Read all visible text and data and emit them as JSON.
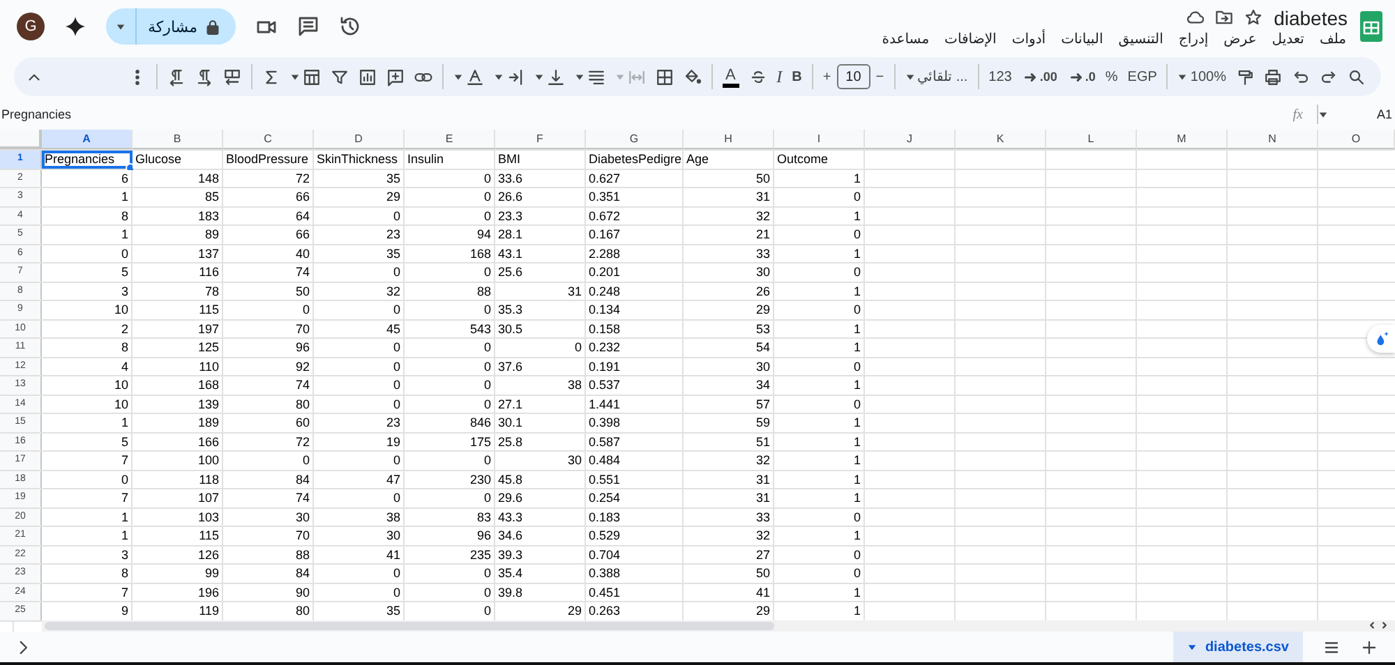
{
  "document": {
    "title": "diabetes"
  },
  "account": {
    "initial": "G"
  },
  "share": {
    "label": "مشاركة"
  },
  "menu": [
    "ملف",
    "تعديل",
    "عرض",
    "إدراج",
    "التنسيق",
    "البيانات",
    "أدوات",
    "الإضافات",
    "مساعدة"
  ],
  "toolbar": [
    {
      "kind": "icon",
      "disabled": false
    },
    {
      "kind": "divider"
    },
    {
      "kind": "icon",
      "disabled": false
    },
    {
      "kind": "icon",
      "disabled": false
    },
    {
      "kind": "icon",
      "disabled": false
    },
    {
      "kind": "divider"
    },
    {
      "kind": "icon",
      "disabled": false
    },
    {
      "kind": "icon",
      "disabled": false,
      "caret": true
    },
    {
      "kind": "icon",
      "disabled": false
    },
    {
      "kind": "icon",
      "disabled": false
    },
    {
      "kind": "icon",
      "disabled": false
    },
    {
      "kind": "icon",
      "disabled": false
    },
    {
      "kind": "divider"
    },
    {
      "kind": "icon",
      "disabled": false,
      "caret": true
    },
    {
      "kind": "icon",
      "disabled": false,
      "caret": true
    },
    {
      "kind": "icon",
      "disabled": false,
      "caret": true
    },
    {
      "kind": "icon",
      "disabled": false,
      "caret": true
    },
    {
      "kind": "icon",
      "disabled": true,
      "caret": true
    },
    {
      "kind": "icon",
      "disabled": false
    },
    {
      "kind": "icon",
      "disabled": false
    },
    {
      "kind": "divider"
    },
    {
      "kind": "underlined",
      "label": "A"
    },
    {
      "kind": "icon",
      "disabled": false
    },
    {
      "kind": "italic",
      "label": "I"
    },
    {
      "kind": "bold",
      "label": "B"
    },
    {
      "kind": "divider"
    },
    {
      "kind": "text",
      "label": "+"
    },
    {
      "kind": "field",
      "value": "10"
    },
    {
      "kind": "text",
      "label": "−"
    },
    {
      "kind": "divider"
    },
    {
      "kind": "dropdown",
      "label": "تلقائي ..."
    },
    {
      "kind": "divider"
    },
    {
      "kind": "text",
      "label": "123"
    },
    {
      "kind": "decimal",
      "label": ".00"
    },
    {
      "kind": "decimal",
      "label": ".0"
    },
    {
      "kind": "text",
      "label": "%"
    },
    {
      "kind": "text",
      "label": "EGP"
    },
    {
      "kind": "divider"
    },
    {
      "kind": "dropdown",
      "label": "100%"
    },
    {
      "kind": "icon",
      "disabled": false
    },
    {
      "kind": "icon",
      "disabled": false
    },
    {
      "kind": "icon",
      "disabled": false
    },
    {
      "kind": "icon",
      "disabled": false
    },
    {
      "kind": "icon",
      "disabled": false
    }
  ],
  "formula_bar": {
    "name_box": "A1",
    "fx_label": "fx",
    "content": "Pregnancies"
  },
  "grid": {
    "columns": [
      {
        "label": "A",
        "selected": true
      },
      {
        "label": "B",
        "selected": false
      },
      {
        "label": "C",
        "selected": false
      },
      {
        "label": "D",
        "selected": false
      },
      {
        "label": "E",
        "selected": false
      },
      {
        "label": "F",
        "selected": false
      },
      {
        "label": "G",
        "selected": false
      },
      {
        "label": "H",
        "selected": false
      },
      {
        "label": "I",
        "selected": false
      },
      {
        "label": "J",
        "selected": false
      },
      {
        "label": "K",
        "selected": false
      },
      {
        "label": "L",
        "selected": false
      },
      {
        "label": "M",
        "selected": false
      },
      {
        "label": "N",
        "selected": false
      },
      {
        "label": "O",
        "selected": false
      }
    ],
    "rows": [
      {
        "number": "1",
        "selected": true,
        "cells": [
          {
            "text": "Pregnancies"
          },
          {
            "text": "Glucose"
          },
          {
            "text": "BloodPressure"
          },
          {
            "text": "SkinThickness"
          },
          {
            "text": "Insulin"
          },
          {
            "text": "BMI"
          },
          {
            "text": "DiabetesPedigre"
          },
          {
            "text": "Age"
          },
          {
            "text": "Outcome"
          }
        ]
      },
      {
        "number": "2",
        "selected": false,
        "cells": [
          "6",
          "148",
          "72",
          "35",
          "0",
          {
            "text": "33.6"
          },
          {
            "text": "0.627"
          },
          "50",
          "1"
        ]
      },
      {
        "number": "3",
        "selected": false,
        "cells": [
          "1",
          "85",
          "66",
          "29",
          "0",
          {
            "text": "26.6"
          },
          {
            "text": "0.351"
          },
          "31",
          "0"
        ]
      },
      {
        "number": "4",
        "selected": false,
        "cells": [
          "8",
          "183",
          "64",
          "0",
          "0",
          {
            "text": "23.3"
          },
          {
            "text": "0.672"
          },
          "32",
          "1"
        ]
      },
      {
        "number": "5",
        "selected": false,
        "cells": [
          "1",
          "89",
          "66",
          "23",
          "94",
          {
            "text": "28.1"
          },
          {
            "text": "0.167"
          },
          "21",
          "0"
        ]
      },
      {
        "number": "6",
        "selected": false,
        "cells": [
          "0",
          "137",
          "40",
          "35",
          "168",
          {
            "text": "43.1"
          },
          {
            "text": "2.288"
          },
          "33",
          "1"
        ]
      },
      {
        "number": "7",
        "selected": false,
        "cells": [
          "5",
          "116",
          "74",
          "0",
          "0",
          {
            "text": "25.6"
          },
          {
            "text": "0.201"
          },
          "30",
          "0"
        ]
      },
      {
        "number": "8",
        "selected": false,
        "cells": [
          "3",
          "78",
          "50",
          "32",
          "88",
          "31",
          {
            "text": "0.248"
          },
          "26",
          "1"
        ]
      },
      {
        "number": "9",
        "selected": false,
        "cells": [
          "10",
          "115",
          "0",
          "0",
          "0",
          {
            "text": "35.3"
          },
          {
            "text": "0.134"
          },
          "29",
          "0"
        ]
      },
      {
        "number": "10",
        "selected": false,
        "cells": [
          "2",
          "197",
          "70",
          "45",
          "543",
          {
            "text": "30.5"
          },
          {
            "text": "0.158"
          },
          "53",
          "1"
        ]
      },
      {
        "number": "11",
        "selected": false,
        "cells": [
          "8",
          "125",
          "96",
          "0",
          "0",
          "0",
          {
            "text": "0.232"
          },
          "54",
          "1"
        ]
      },
      {
        "number": "12",
        "selected": false,
        "cells": [
          "4",
          "110",
          "92",
          "0",
          "0",
          {
            "text": "37.6"
          },
          {
            "text": "0.191"
          },
          "30",
          "0"
        ]
      },
      {
        "number": "13",
        "selected": false,
        "cells": [
          "10",
          "168",
          "74",
          "0",
          "0",
          "38",
          {
            "text": "0.537"
          },
          "34",
          "1"
        ]
      },
      {
        "number": "14",
        "selected": false,
        "cells": [
          "10",
          "139",
          "80",
          "0",
          "0",
          {
            "text": "27.1"
          },
          {
            "text": "1.441"
          },
          "57",
          "0"
        ]
      },
      {
        "number": "15",
        "selected": false,
        "cells": [
          "1",
          "189",
          "60",
          "23",
          "846",
          {
            "text": "30.1"
          },
          {
            "text": "0.398"
          },
          "59",
          "1"
        ]
      },
      {
        "number": "16",
        "selected": false,
        "cells": [
          "5",
          "166",
          "72",
          "19",
          "175",
          {
            "text": "25.8"
          },
          {
            "text": "0.587"
          },
          "51",
          "1"
        ]
      },
      {
        "number": "17",
        "selected": false,
        "cells": [
          "7",
          "100",
          "0",
          "0",
          "0",
          "30",
          {
            "text": "0.484"
          },
          "32",
          "1"
        ]
      },
      {
        "number": "18",
        "selected": false,
        "cells": [
          "0",
          "118",
          "84",
          "47",
          "230",
          {
            "text": "45.8"
          },
          {
            "text": "0.551"
          },
          "31",
          "1"
        ]
      },
      {
        "number": "19",
        "selected": false,
        "cells": [
          "7",
          "107",
          "74",
          "0",
          "0",
          {
            "text": "29.6"
          },
          {
            "text": "0.254"
          },
          "31",
          "1"
        ]
      },
      {
        "number": "20",
        "selected": false,
        "cells": [
          "1",
          "103",
          "30",
          "38",
          "83",
          {
            "text": "43.3"
          },
          {
            "text": "0.183"
          },
          "33",
          "0"
        ]
      },
      {
        "number": "21",
        "selected": false,
        "cells": [
          "1",
          "115",
          "70",
          "30",
          "96",
          {
            "text": "34.6"
          },
          {
            "text": "0.529"
          },
          "32",
          "1"
        ]
      },
      {
        "number": "22",
        "selected": false,
        "cells": [
          "3",
          "126",
          "88",
          "41",
          "235",
          {
            "text": "39.3"
          },
          {
            "text": "0.704"
          },
          "27",
          "0"
        ]
      },
      {
        "number": "23",
        "selected": false,
        "cells": [
          "8",
          "99",
          "84",
          "0",
          "0",
          {
            "text": "35.4"
          },
          {
            "text": "0.388"
          },
          "50",
          "0"
        ]
      },
      {
        "number": "24",
        "selected": false,
        "cells": [
          "7",
          "196",
          "90",
          "0",
          "0",
          {
            "text": "39.8"
          },
          {
            "text": "0.451"
          },
          "41",
          "1"
        ]
      },
      {
        "number": "25",
        "selected": false,
        "cells": [
          "9",
          "119",
          "80",
          "35",
          "0",
          "29",
          {
            "text": "0.263"
          },
          "29",
          "1"
        ]
      }
    ]
  },
  "sheet_tabs": [
    {
      "label": "diabetes.csv",
      "selected": true
    }
  ]
}
